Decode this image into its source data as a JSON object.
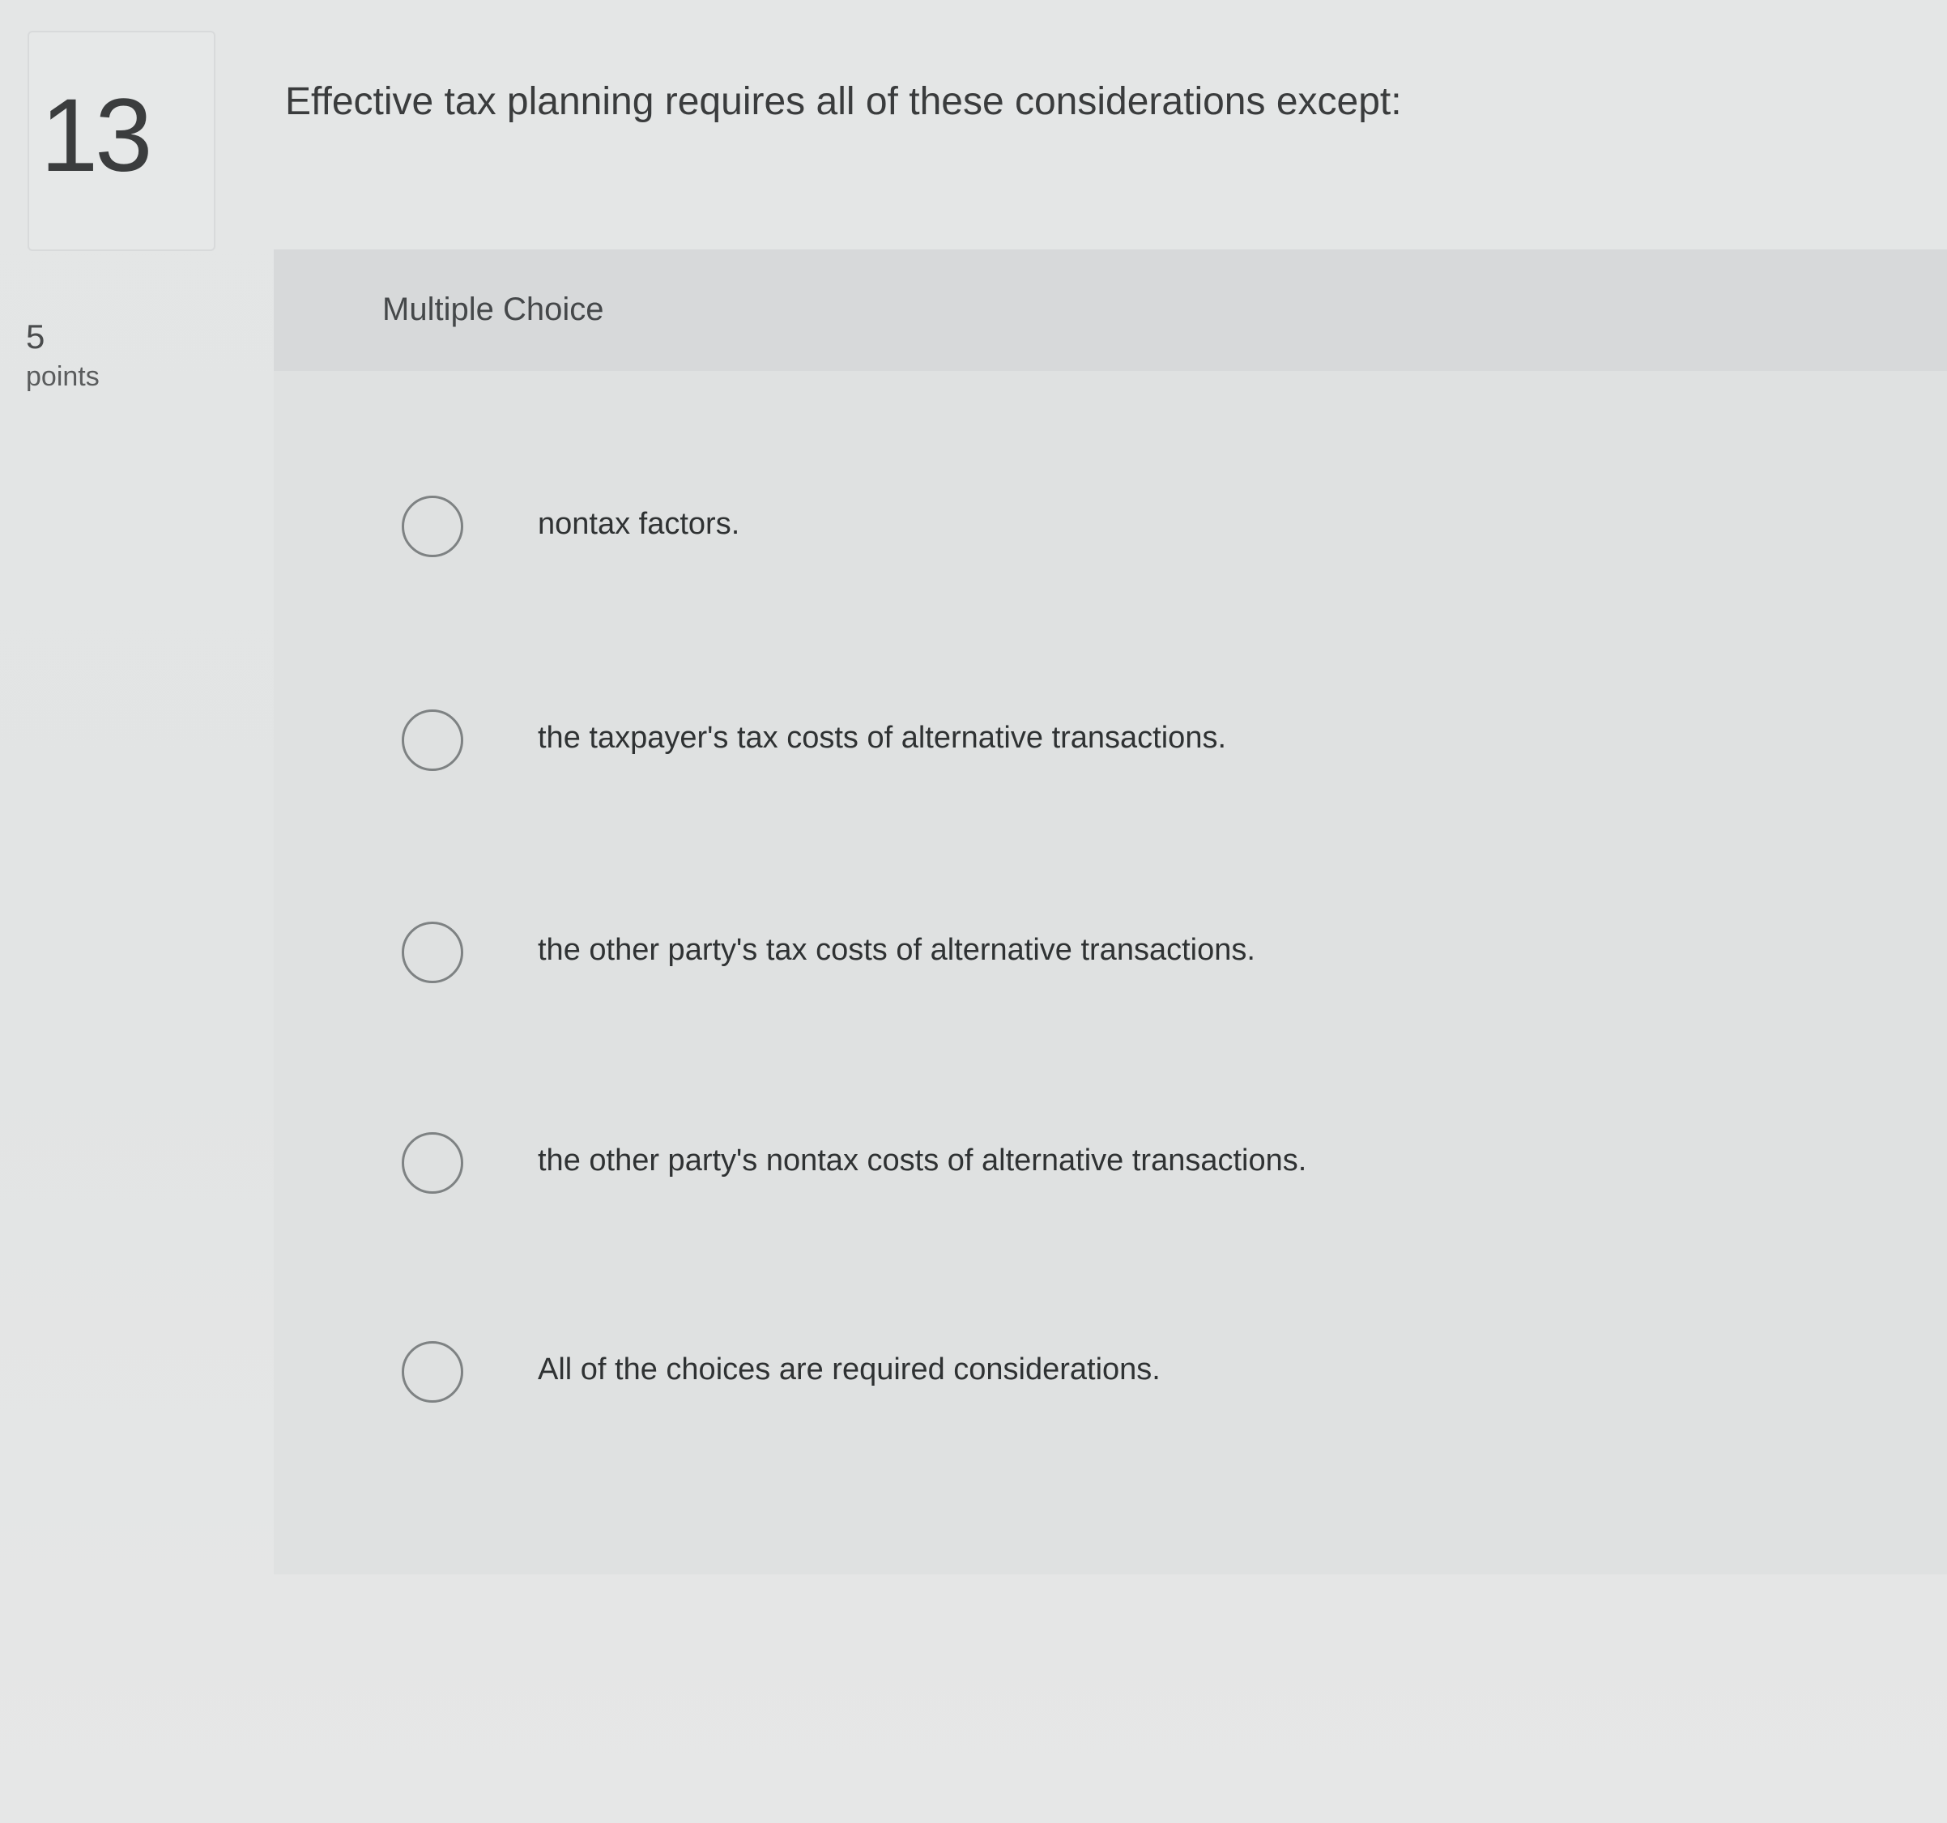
{
  "question": {
    "number": "13",
    "points_value": "5",
    "points_label": "points",
    "prompt": "Effective tax planning requires all of these considerations except:",
    "type_label": "Multiple Choice"
  },
  "options": [
    {
      "label": "nontax factors.",
      "selected": false
    },
    {
      "label": "the taxpayer's tax costs of alternative transactions.",
      "selected": false
    },
    {
      "label": "the other party's tax costs of alternative transactions.",
      "selected": false
    },
    {
      "label": "the other party's nontax costs of alternative transactions.",
      "selected": false
    },
    {
      "label": "All of the choices are required considerations.",
      "selected": false
    }
  ]
}
